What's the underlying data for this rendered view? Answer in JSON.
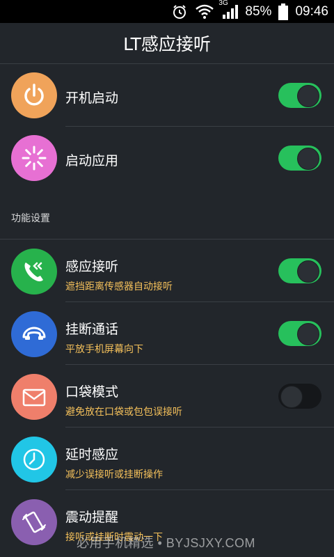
{
  "status_bar": {
    "network": "3G",
    "battery": "85%",
    "time": "09:46",
    "icons": [
      "alarm-icon",
      "wifi-icon",
      "signal-icon",
      "battery-icon"
    ]
  },
  "app_bar": {
    "title": "LT感应接听"
  },
  "top_items": [
    {
      "label": "开机启动",
      "icon": "power-icon",
      "icon_color": "#f0a35a",
      "enabled": true
    },
    {
      "label": "启动应用",
      "icon": "loading-spinner-icon",
      "icon_color": "#e770d3",
      "enabled": true
    }
  ],
  "section_header": "功能设置",
  "feature_items": [
    {
      "label": "感应接听",
      "sub": "遮挡距离传感器自动接听",
      "icon": "phone-answer-icon",
      "icon_color": "#27b24c",
      "enabled": true
    },
    {
      "label": "挂断通话",
      "sub": "平放手机屏幕向下",
      "icon": "phone-hangup-icon",
      "icon_color": "#2f6bd6",
      "enabled": true
    },
    {
      "label": "口袋模式",
      "sub": "避免放在口袋或包包误接听",
      "icon": "envelope-icon",
      "icon_color": "#ef7f6b",
      "enabled": false
    },
    {
      "label": "延时感应",
      "sub": "减少误接听或挂断操作",
      "icon": "clock-icon",
      "icon_color": "#21c6e6",
      "enabled": null
    },
    {
      "label": "震动提醒",
      "sub": "接听或挂断时震动一下",
      "icon": "vibrate-phone-icon",
      "icon_color": "#8a5fb0",
      "enabled": null
    }
  ],
  "watermark": "必用手机精选 • BYJSJXY.COM",
  "colors": {
    "background": "#22262b",
    "toggle_on": "#27c05c",
    "subtitle": "#f5c15b"
  }
}
